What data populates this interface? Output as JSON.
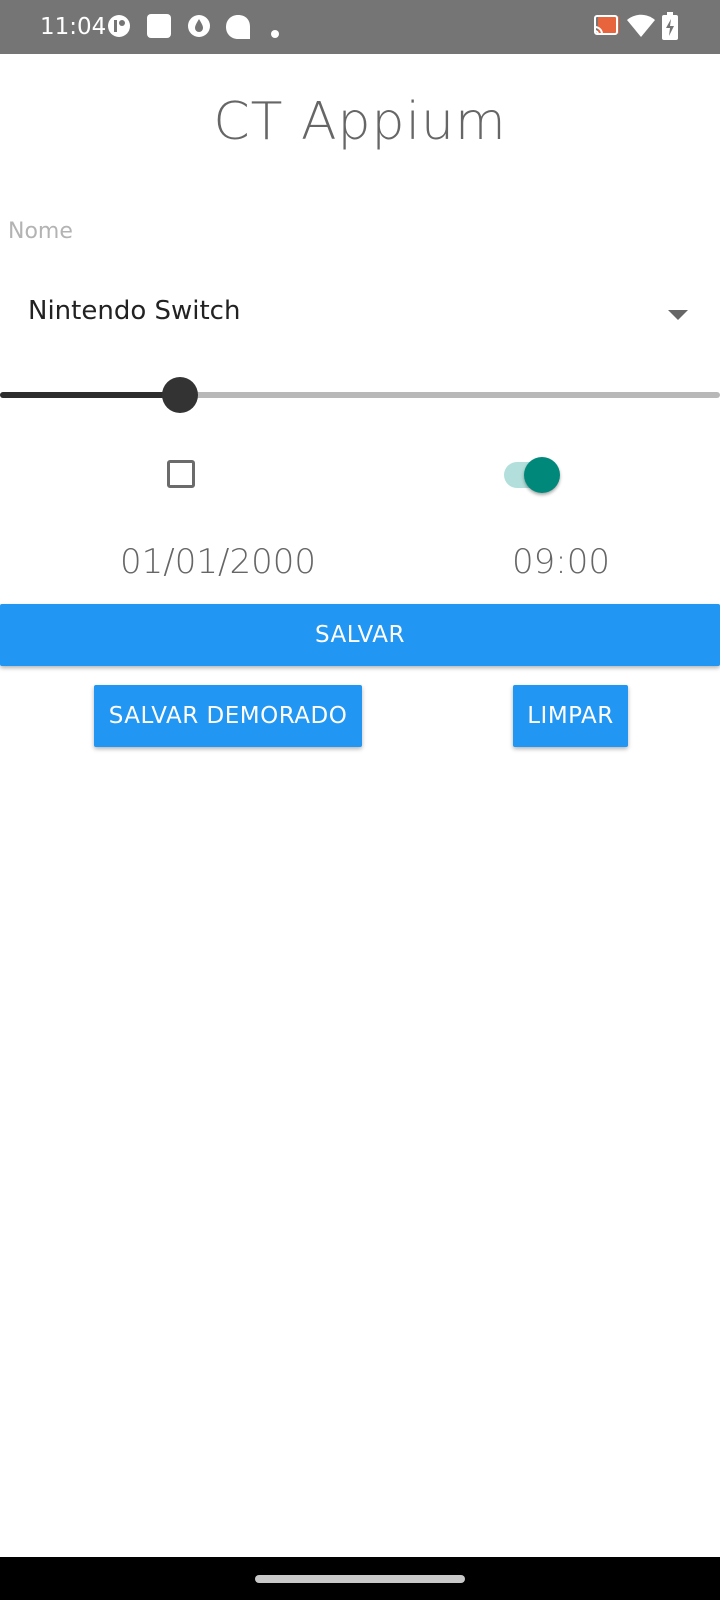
{
  "status_bar": {
    "time": "11:04",
    "left_icons": [
      "notification-app-icon",
      "notification-square-icon",
      "notification-drop-icon",
      "notification-blob-icon",
      "more-notifications-dot-icon"
    ],
    "right_icons": [
      "cast-icon",
      "wifi-icon",
      "battery-charging-icon"
    ],
    "cast_accent_color": "#e8643c"
  },
  "app": {
    "title": "CT Appium",
    "name_field": {
      "placeholder": "Nome",
      "value": ""
    },
    "console_select": {
      "selected": "Nintendo Switch"
    },
    "slider": {
      "value_fraction": 0.25
    },
    "checkbox": {
      "checked": false
    },
    "switch": {
      "on": true,
      "color": "#00897b"
    },
    "date": "01/01/2000",
    "time": "09:00",
    "buttons": {
      "save": "SALVAR",
      "save_delayed": "SALVAR DEMORADO",
      "clear": "LIMPAR",
      "color": "#2196f3"
    }
  }
}
